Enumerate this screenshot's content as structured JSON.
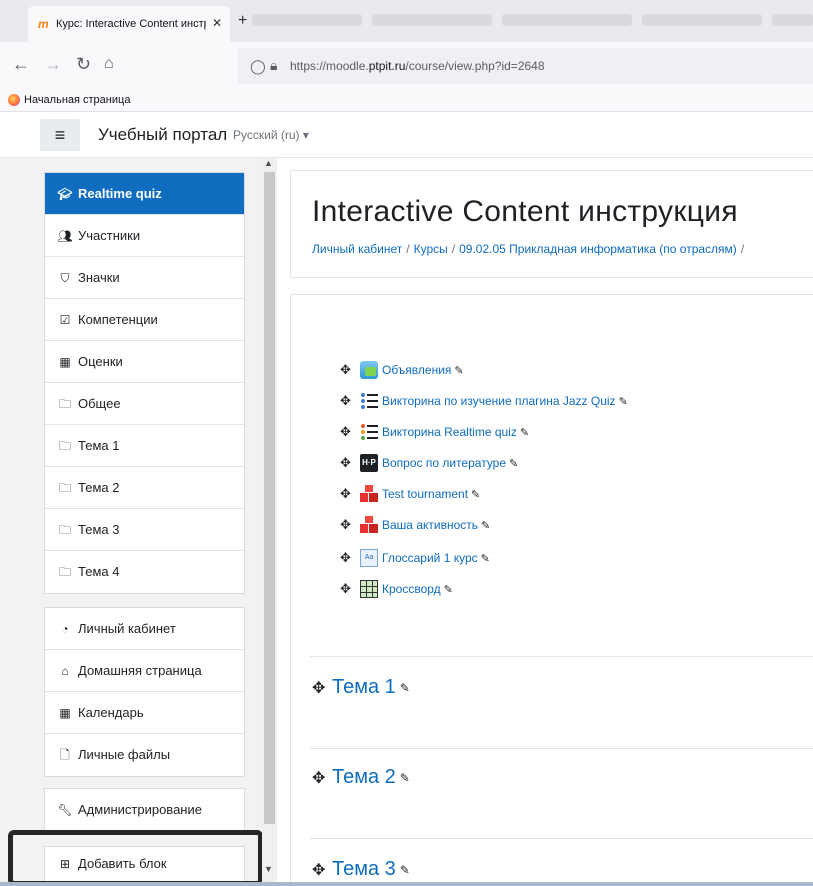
{
  "browser": {
    "tab_title": "Курс: Interactive Content инстр",
    "tab_close": "✕",
    "new_tab": "+",
    "url_prefix": "https://moodle.",
    "url_domain": "ptpit.ru",
    "url_path": "/course/view.php?id=2648",
    "bookmark": "Начальная страница"
  },
  "moodle": {
    "site_name": "Учебный портал",
    "language": "Русский (ru) ▾"
  },
  "drawer": {
    "course_items": [
      {
        "icon": "graduation-cap-icon",
        "label": "Realtime quiz"
      },
      {
        "icon": "users-icon",
        "label": "Участники"
      },
      {
        "icon": "shield-icon",
        "label": "Значки"
      },
      {
        "icon": "check-square-icon",
        "label": "Компетенции"
      },
      {
        "icon": "table-icon",
        "label": "Оценки"
      },
      {
        "icon": "folder-icon",
        "label": "Общее"
      },
      {
        "icon": "folder-icon",
        "label": "Тема 1"
      },
      {
        "icon": "folder-icon",
        "label": "Тема 2"
      },
      {
        "icon": "folder-icon",
        "label": "Тема 3"
      },
      {
        "icon": "folder-icon",
        "label": "Тема 4"
      }
    ],
    "site_items": [
      {
        "icon": "tachometer-icon",
        "label": "Личный кабинет"
      },
      {
        "icon": "home-icon",
        "label": "Домашняя страница"
      },
      {
        "icon": "calendar-icon",
        "label": "Календарь"
      },
      {
        "icon": "file-icon",
        "label": "Личные файлы"
      }
    ],
    "admin_item": {
      "icon": "wrench-icon",
      "label": "Администрирование"
    },
    "add_block": {
      "icon": "plus-square-icon",
      "label": "Добавить блок"
    }
  },
  "page": {
    "title": "Interactive Content инструкция",
    "breadcrumb": [
      "Личный кабинет",
      "Курсы",
      "09.02.05 Прикладная информатика (по отраслям)"
    ],
    "breadcrumb_separator": "/"
  },
  "activities": [
    {
      "icon": "forum-icon",
      "label": "Объявления"
    },
    {
      "icon": "jazz-quiz-icon",
      "label": "Викторина по изучение плагина Jazz Quiz"
    },
    {
      "icon": "realtime-quiz-icon",
      "label": "Викторина Realtime quiz"
    },
    {
      "icon": "h5p-icon",
      "label": "Вопрос по литературе"
    },
    {
      "icon": "blocks-icon",
      "label": "Test tournament"
    },
    {
      "icon": "blocks-icon",
      "label": "Ваша активность"
    },
    {
      "icon": "glossary-icon",
      "label": "Глоссарий 1 курс"
    },
    {
      "icon": "crossword-icon",
      "label": "Кроссворд"
    }
  ],
  "sections": [
    "Тема 1",
    "Тема 2",
    "Тема 3"
  ],
  "colors": {
    "accent": "#0f6cbf",
    "drawer_bg": "#f2f2f2",
    "active_item_bg": "#0f6cbf"
  }
}
